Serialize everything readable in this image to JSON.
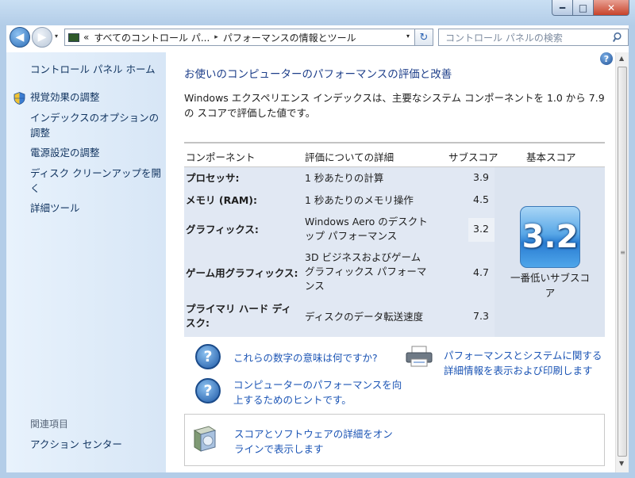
{
  "window": {
    "min_label": "━",
    "max_label": "□",
    "close_label": "✕"
  },
  "nav": {
    "back_glyph": "◀",
    "forward_glyph": "▶",
    "dropdown_glyph": "▾",
    "breadcrumb_overflow": "«",
    "breadcrumb": [
      "すべてのコントロール パ...",
      "パフォーマンスの情報とツール"
    ],
    "separator": "▸",
    "refresh_glyph": "↻",
    "search_placeholder": "コントロール パネルの検索"
  },
  "sidebar": {
    "home": "コントロール パネル ホーム",
    "items": [
      {
        "label": "視覚効果の調整"
      },
      {
        "label": "インデックスのオプションの調整"
      },
      {
        "label": "電源設定の調整"
      },
      {
        "label": "ディスク クリーンアップを開く"
      },
      {
        "label": "詳細ツール"
      }
    ],
    "related_heading": "関連項目",
    "related": [
      {
        "label": "アクション センター"
      }
    ]
  },
  "main": {
    "help_glyph": "?",
    "heading": "お使いのコンピューターのパフォーマンスの評価と改善",
    "intro": "Windows エクスペリエンス インデックスは、主要なシステム コンポーネントを 1.0 から 7.9 の スコアで評価した値です。",
    "table": {
      "headers": {
        "component": "コンポーネント",
        "detail": "評価についての詳細",
        "subscore": "サブスコア",
        "base": "基本スコア"
      },
      "rows": [
        {
          "component": "プロセッサ:",
          "detail": "1 秒あたりの計算",
          "subscore": "3.9"
        },
        {
          "component": "メモリ (RAM):",
          "detail": "1 秒あたりのメモリ操作",
          "subscore": "4.5"
        },
        {
          "component": "グラフィックス:",
          "detail": "Windows Aero のデスクトップ パフォーマンス",
          "subscore": "3.2"
        },
        {
          "component": "ゲーム用グラフィックス:",
          "detail": "3D ビジネスおよびゲーム グラフィックス パフォーマンス",
          "subscore": "4.7"
        },
        {
          "component": "プライマリ ハード ディスク:",
          "detail": "ディスクのデータ転送速度",
          "subscore": "7.3"
        }
      ],
      "base_score": "3.2",
      "base_caption": "一番低いサブスコア"
    },
    "links": {
      "meaning": "これらの数字の意味は何ですか?",
      "tips": "コンピューターのパフォーマンスを向上するためのヒントです。",
      "print": "パフォーマンスとシステムに関する詳細情報を表示および印刷します",
      "online": "スコアとソフトウェアの詳細をオンラインで表示します",
      "q_glyph": "?"
    }
  },
  "colors": {
    "link": "#1c55b5",
    "heading": "#1e3f8a",
    "sidebar_bg": "#e8f2fc",
    "table_bg": "#e1e8f3",
    "score_tile": "#2a7dd2"
  }
}
